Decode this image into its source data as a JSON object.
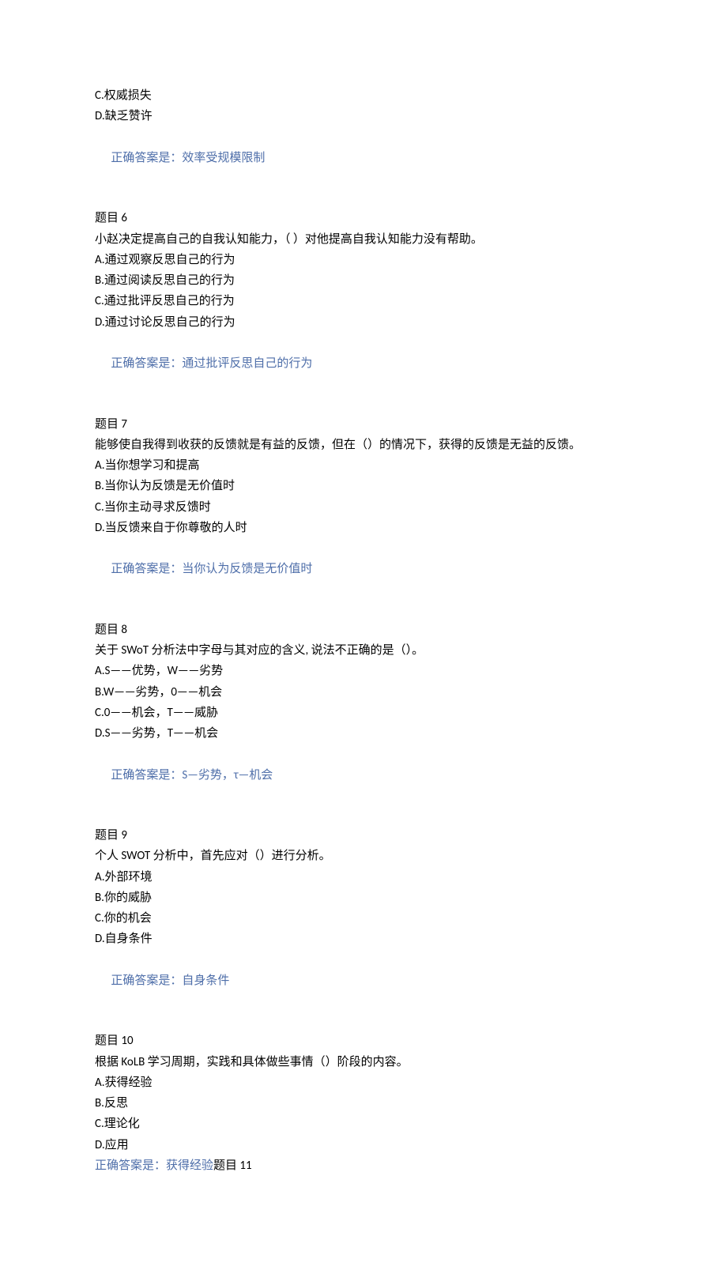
{
  "partial_q5": {
    "optC": "C.权威损失",
    "optD": "D.缺乏赞许",
    "answer_label": "正确答案是：",
    "answer_text": "效率受规模限制"
  },
  "q6": {
    "title": "题目 6",
    "stem": "小赵决定提高自己的自我认知能力，（ ）对他提高自我认知能力没有帮助。",
    "optA": "A.通过观察反思自己的行为",
    "optB": "B.通过阅读反思自己的行为",
    "optC": "C.通过批评反思自己的行为",
    "optD": "D.通过讨论反思自己的行为",
    "answer_label": "正确答案是：",
    "answer_text": "通过批评反思自己的行为"
  },
  "q7": {
    "title": "题目 7",
    "stem": "能够使自我得到收获的反馈就是有益的反馈，但在（）的情况下，获得的反馈是无益的反馈。",
    "optA": "A.当你想学习和提高",
    "optB": "B.当你认为反馈是无价值时",
    "optC": "C.当你主动寻求反馈时",
    "optD": "D.当反馈来自于你尊敬的人时",
    "answer_label": "正确答案是：",
    "answer_text": "当你认为反馈是无价值时"
  },
  "q8": {
    "title": "题目 8",
    "stem": "关于 SWoT 分析法中字母与其对应的含义, 说法不正确的是（）。",
    "optA": "A.S——优势，W——劣势",
    "optB": "B.W——劣势，0——机会",
    "optC": "C.0——机会，T——威胁",
    "optD": "D.S——劣势，T——机会",
    "answer_label": "正确答案是：",
    "answer_text": "S—劣势，τ—机会"
  },
  "q9": {
    "title": "题目 9",
    "stem": "个人 SWOT 分析中，首先应对（）进行分析。",
    "optA": "A.外部环境",
    "optB": "B.你的威胁",
    "optC": "C.你的机会",
    "optD": "D.自身条件",
    "answer_label": "正确答案是：",
    "answer_text": "自身条件"
  },
  "q10": {
    "title": "题目 10",
    "stem": "根据 KoLB 学习周期，实践和具体做些事情（）阶段的内容。",
    "optA": "A.获得经验",
    "optB": "B.反思",
    "optC": "C.理论化",
    "optD": "D.应用",
    "answer_label": "正确答案是：",
    "answer_text": "获得经验",
    "trailing": "题目 11"
  }
}
